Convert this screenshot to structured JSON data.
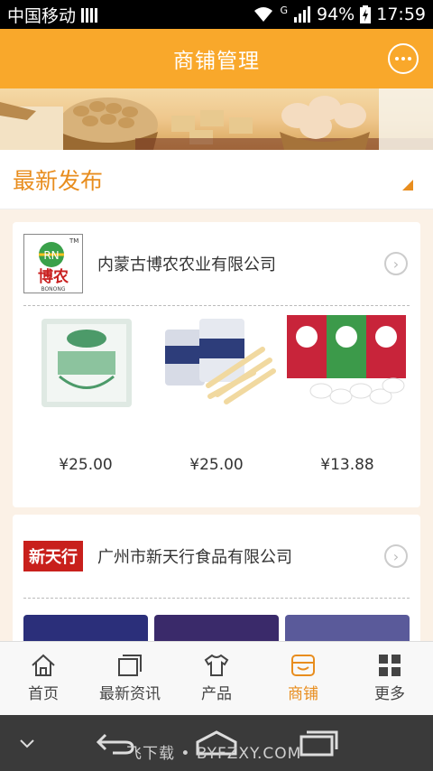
{
  "status_bar": {
    "carrier": "中国移动",
    "network": "G",
    "battery": "94%",
    "time": "17:59"
  },
  "header": {
    "title": "商铺管理",
    "chat_icon": "chat-bubble-icon",
    "accent": "#f9a82b"
  },
  "section": {
    "title": "最新发布",
    "color": "#e88d1e"
  },
  "shops": [
    {
      "logo": {
        "text": "博农",
        "sub": "BONONG",
        "mark": "TM",
        "initials": "RN"
      },
      "name": "内蒙古博农农业有限公司",
      "products": [
        {
          "price": "¥25.00",
          "image": "milk-candy-bag-image"
        },
        {
          "price": "¥25.00",
          "image": "milk-stick-jars-image"
        },
        {
          "price": "¥13.88",
          "image": "fresh-milk-shell-packs-image"
        }
      ]
    },
    {
      "logo": {
        "text": "新天行"
      },
      "name": "广州市新天行食品有限公司",
      "products": [
        {
          "image": "pascual-dessert-image"
        },
        {
          "image": "pascual-dessert-purple-image"
        },
        {
          "image": "pascual-dessert-blue-image"
        }
      ]
    }
  ],
  "bottom_nav": [
    {
      "label": "首页",
      "icon": "home-icon"
    },
    {
      "label": "最新资讯",
      "icon": "news-icon"
    },
    {
      "label": "产品",
      "icon": "shirt-icon"
    },
    {
      "label": "商铺",
      "icon": "shop-icon",
      "active": true
    },
    {
      "label": "更多",
      "icon": "grid-icon"
    }
  ],
  "system_nav": {
    "watermark": "飞下载 • BYFZXY.COM"
  }
}
